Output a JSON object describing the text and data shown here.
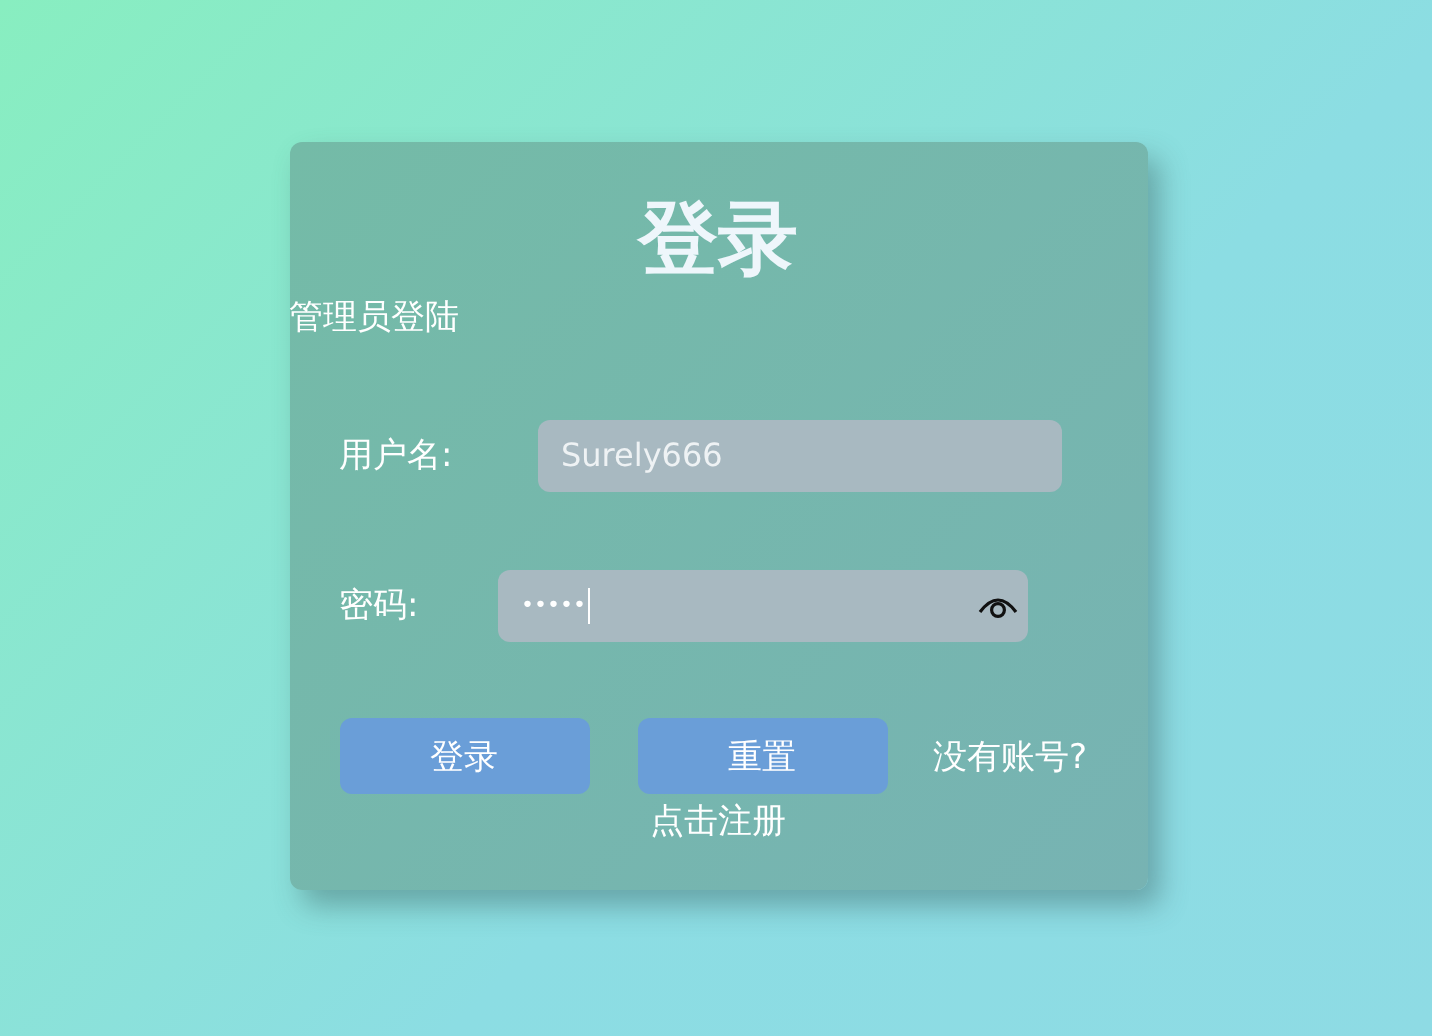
{
  "title": "登录",
  "subtitle": "管理员登陆",
  "fields": [
    {
      "label": "用户名:",
      "value": "Surely666",
      "kind": "text"
    },
    {
      "label": "密码:",
      "value": "•••••",
      "kind": "password"
    }
  ],
  "buttons": [
    "登录",
    "重置"
  ],
  "register": {
    "prompt": "没有账号?",
    "link": "点击注册"
  }
}
